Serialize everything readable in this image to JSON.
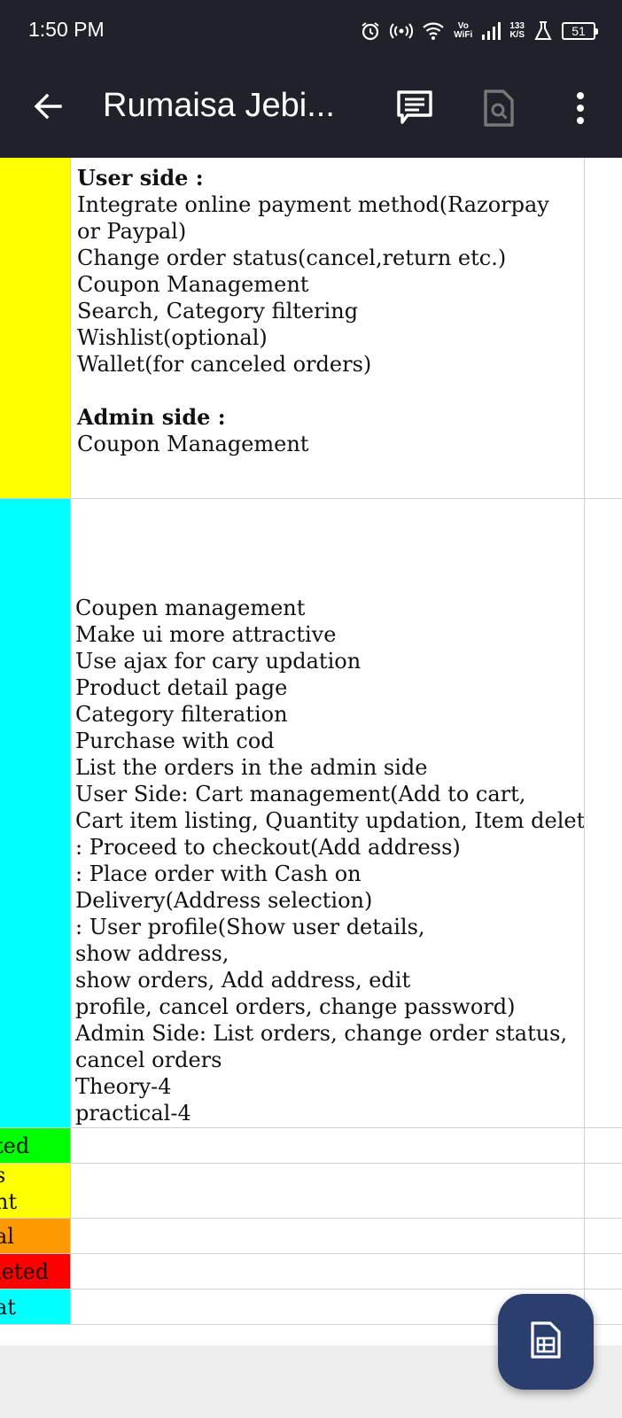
{
  "status_bar": {
    "time": "1:50 PM",
    "volte_top": "Vo",
    "volte_bottom": "WiFi",
    "speed_value": "133",
    "speed_unit": "K/S",
    "battery": "51"
  },
  "appbar": {
    "title": "Rumaisa Jebi..."
  },
  "rows": [
    {
      "color": "#ffff00",
      "content": [
        {
          "text": "User side :",
          "bold": true
        },
        {
          "text": "Integrate online payment method(Razorpay",
          "bold": false
        },
        {
          "text": "or Paypal)",
          "bold": false
        },
        {
          "text": "Change order status(cancel,return etc.)",
          "bold": false
        },
        {
          "text": "Coupon Management",
          "bold": false
        },
        {
          "text": "Search, Category filtering",
          "bold": false
        },
        {
          "text": "Wishlist(optional)",
          "bold": false
        },
        {
          "text": "Wallet(for canceled orders)",
          "bold": false
        },
        {
          "text": "",
          "bold": false
        },
        {
          "text": "Admin side :",
          "bold": true
        },
        {
          "text": "Coupon Management",
          "bold": false
        }
      ]
    },
    {
      "color": "#00ffff",
      "content": [
        {
          "text": "Coupen management"
        },
        {
          "text": "Make ui more attractive"
        },
        {
          "text": "Use ajax for cary updation"
        },
        {
          "text": "Product detail page"
        },
        {
          "text": "Category filteration"
        },
        {
          "text": "Purchase with cod"
        },
        {
          "text": "List the orders in the admin side"
        },
        {
          "text": "User Side: Cart management(Add to cart,"
        },
        {
          "text": "Cart item listing, Quantity updation, Item deletion)"
        },
        {
          "text": ": Proceed to checkout(Add address)"
        },
        {
          "text": ": Place order with Cash on"
        },
        {
          "text": "Delivery(Address selection)"
        },
        {
          "text": ": User profile(Show user details,"
        },
        {
          "text": "show address,"
        },
        {
          "text": "show orders, Add address, edit"
        },
        {
          "text": "profile, cancel orders, change password)"
        },
        {
          "text": "Admin Side: List orders, change order status,"
        },
        {
          "text": "cancel orders"
        },
        {
          "text": "Theory-4"
        },
        {
          "text": "practical-4"
        }
      ]
    }
  ],
  "legend": [
    {
      "color": "#00ff00",
      "lines": [
        "ted"
      ]
    },
    {
      "color": "#ffff00",
      "lines": [
        "s",
        "nt"
      ]
    },
    {
      "color": "#ff9900",
      "lines": [
        "al"
      ]
    },
    {
      "color": "#ff0000",
      "lines": [
        "leted"
      ]
    },
    {
      "color": "#00ffff",
      "lines": [
        "at"
      ]
    }
  ]
}
